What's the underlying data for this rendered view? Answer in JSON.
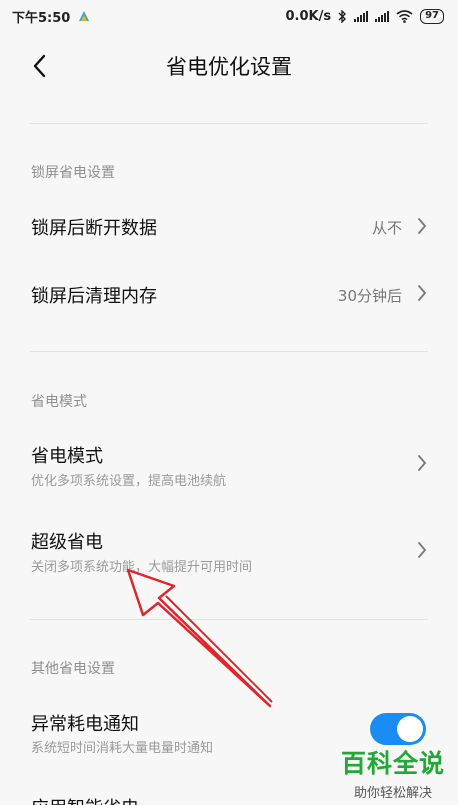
{
  "status_bar": {
    "time": "下午5:50",
    "net_speed": "0.0K/s",
    "battery": "97"
  },
  "header": {
    "title": "省电优化设置"
  },
  "sections": [
    {
      "label": "锁屏省电设置",
      "items": [
        {
          "title": "锁屏后断开数据",
          "value": "从不"
        },
        {
          "title": "锁屏后清理内存",
          "value": "30分钟后"
        }
      ]
    },
    {
      "label": "省电模式",
      "items": [
        {
          "title": "省电模式",
          "subtitle": "优化多项系统设置，提高电池续航"
        },
        {
          "title": "超级省电",
          "subtitle": "关闭多项系统功能，大幅提升可用时间"
        }
      ]
    },
    {
      "label": "其他省电设置",
      "items": [
        {
          "title": "异常耗电通知",
          "subtitle": "系统短时间消耗大量电量时通知",
          "toggle_on": true
        },
        {
          "title": "应用智能省电"
        }
      ]
    }
  ],
  "watermark": {
    "main": "百科全说",
    "sub": "助你轻松解决"
  },
  "colors": {
    "toggle_on": "#1a8df5",
    "annotation_arrow": "#e0262b",
    "watermark": "#21a836"
  }
}
